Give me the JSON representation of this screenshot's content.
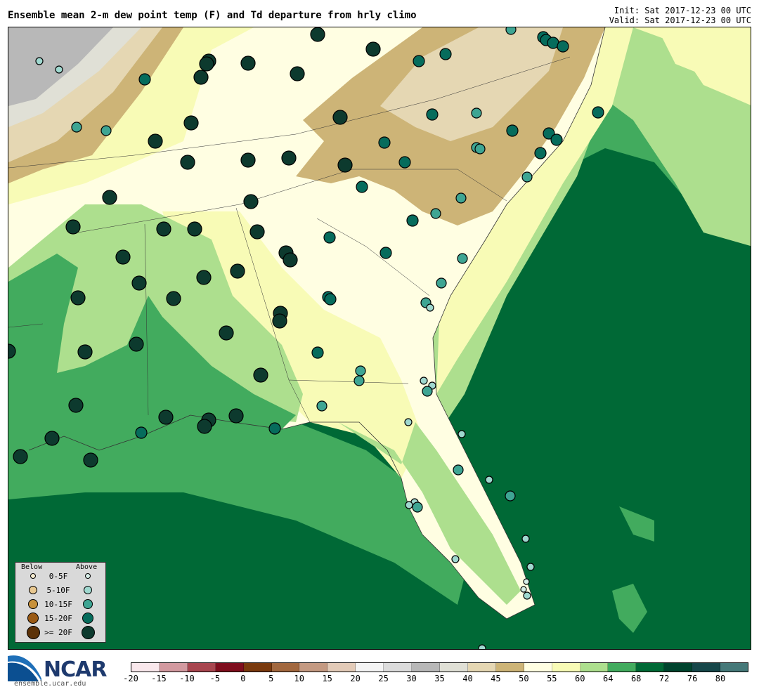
{
  "header": {
    "title": "Ensemble mean 2-m dew point temp (F) and Td departure from hrly climo",
    "init": "Init: Sat 2017-12-23 00 UTC",
    "valid": "Valid: Sat 2017-12-23 00 UTC"
  },
  "legend": {
    "below_label": "Below",
    "above_label": "Above",
    "rows": [
      {
        "label": "0-5F",
        "below_color": "#f6ecd0",
        "above_color": "#d8efe9"
      },
      {
        "label": "5-10F",
        "below_color": "#e8c890",
        "above_color": "#9fd8cf"
      },
      {
        "label": "10-15F",
        "below_color": "#c8913a",
        "above_color": "#3ea593"
      },
      {
        "label": "15-20F",
        "below_color": "#9a5a14",
        "above_color": "#066c5c"
      },
      {
        "label": ">= 20F",
        "below_color": "#5c3208",
        "above_color": "#0d3a2e"
      }
    ]
  },
  "logo": {
    "text": "NCAR",
    "url": "ensemble.ucar.edu"
  },
  "colorbar": {
    "colors": [
      "#f9e8ec",
      "#d39aa0",
      "#a8464f",
      "#7f0e1e",
      "#7a3a0e",
      "#a2683f",
      "#c49a82",
      "#e3cbb8",
      "#f4f4f4",
      "#dcdcdc",
      "#b8b8b8",
      "#e0e0d6",
      "#e5d7b3",
      "#cdb477",
      "#fffee2",
      "#f8fbb6",
      "#addf8e",
      "#42ab5e",
      "#006936",
      "#00442e",
      "#17474a",
      "#467979"
    ],
    "ticks": [
      "-20",
      "-15",
      "-10",
      "-5",
      "0",
      "5",
      "10",
      "15",
      "20",
      "25",
      "30",
      "35",
      "40",
      "45",
      "50",
      "55",
      "60",
      "64",
      "68",
      "72",
      "76",
      "80"
    ]
  },
  "colors": {
    "ocean": "#006936",
    "land_50s": "#fffee2",
    "land_55": "#f8fbb6",
    "land_60": "#addf8e",
    "land_64": "#42ab5e",
    "land_45": "#cdb477",
    "land_40": "#e5d7b3",
    "land_35": "#e0e0d6",
    "land_30": "#b8b8b8"
  }
}
